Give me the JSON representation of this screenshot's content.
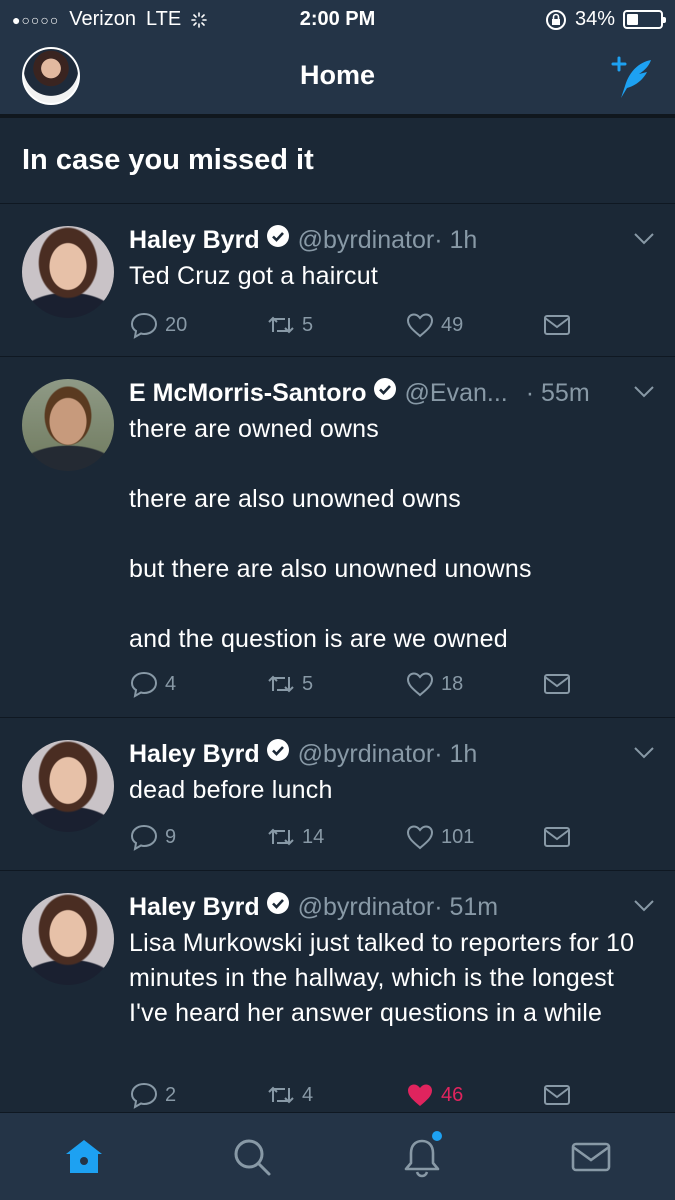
{
  "status_bar": {
    "signal": "●○○○○",
    "carrier": "Verizon",
    "network": "LTE",
    "time": "2:00 PM",
    "battery": "34%",
    "battery_level": 0.34
  },
  "nav": {
    "title": "Home"
  },
  "section": {
    "title": "In case you missed it"
  },
  "tweets": [
    {
      "name": "Haley Byrd",
      "handle": "@byrdinator",
      "time": "· 1h",
      "text": "Ted Cruz got a haircut",
      "replies": "20",
      "retweets": "5",
      "likes": "49",
      "liked": false
    },
    {
      "name": "E McMorris-Santoro",
      "handle": "@Evan...",
      "time": "· 55m",
      "text": "there are owned owns\n\nthere are also unowned owns\n\nbut there are also unowned unowns\n\nand the question is are we owned",
      "replies": "4",
      "retweets": "5",
      "likes": "18",
      "liked": false
    },
    {
      "name": "Haley Byrd",
      "handle": "@byrdinator",
      "time": "· 1h",
      "text": "dead before lunch",
      "replies": "9",
      "retweets": "14",
      "likes": "101",
      "liked": false
    },
    {
      "name": "Haley Byrd",
      "handle": "@byrdinator",
      "time": "· 51m",
      "text": "Lisa Murkowski just talked to reporters for 10 minutes in the hallway, which is the longest I've heard her answer questions in a while",
      "replies": "2",
      "retweets": "4",
      "likes": "46",
      "liked": true
    }
  ],
  "tab_bar": {
    "items": [
      "home-icon",
      "search-icon",
      "notifications-icon",
      "messages-icon"
    ],
    "active": "home-icon",
    "notification_dot": true
  },
  "colors": {
    "background": "#1b2836",
    "bar": "#243447",
    "accent": "#1da1f2",
    "muted": "#8899a6",
    "like": "#e0245e"
  }
}
